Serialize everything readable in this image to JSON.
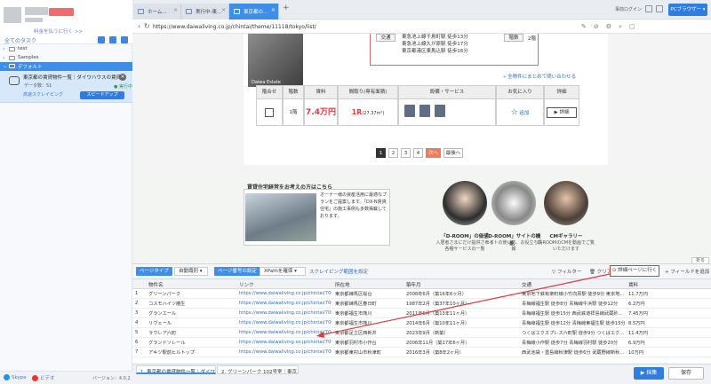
{
  "sidebar": {
    "back_link": "料金を払うに行く >>",
    "all_tasks": "全てのタスク",
    "tree": [
      {
        "label": "test"
      },
      {
        "label": "Samples"
      },
      {
        "label": "デフォルト"
      }
    ],
    "task": {
      "title": "東京都の賃貸物件一覧｜ダイワハウスの賃貸...",
      "count": "データ数：51",
      "status": "● 実行中",
      "mode": "高速スクレイピング",
      "speed_button": "スピードアップ"
    },
    "footer": {
      "skype": "Skype",
      "video": "ビデオ",
      "version": "バージョン：4.0.2"
    }
  },
  "browser": {
    "tabs": [
      {
        "label": "ホーム..."
      },
      {
        "label": "実行中-東..."
      },
      {
        "label": "東京都の..."
      }
    ],
    "new_tab": "+",
    "login": "事前ログイン",
    "pc_browser": "PCブラウザー ▾",
    "url": "https://www.daiwaliving.co.jp/chintai/theme/11118/tokyo/list/"
  },
  "listing": {
    "photo_label": "Daiwa Estate",
    "access_label": "交通",
    "access_lines": [
      "東急池上線千鳥町駅 徒歩13分",
      "東急池上線久が原駅 徒歩17分",
      "東京都港区東馬込駅 徒歩16分"
    ],
    "layout_label": "階数",
    "layout_value": "2階",
    "bulk_link": "» 全物件にまとめて問い合わせる",
    "table_headers": [
      "階合せ",
      "階数",
      "賃料",
      "間取り(専有面積)",
      "設備・サービス",
      "お気に入り",
      "詳細"
    ],
    "row": {
      "floor": "1階",
      "rent": "7.4万円",
      "layout": "1R",
      "area": "(27.37m²)",
      "fav": "追加",
      "detail": "▶ 詳細"
    }
  },
  "pagination": {
    "pages": [
      "1",
      "2",
      "3",
      "4"
    ],
    "next": "次へ",
    "last": "最後へ"
  },
  "promo": {
    "title": "賃貸住宅経営をお考えの方はこちら",
    "text": "オーナー様の資産活用に最適なプランをご提案します。「DX-N賃貸住宅」の施工事例も多数掲載しております。",
    "features": [
      {
        "title": "「D-ROOM」の価値",
        "sub": "入居者さまにだけ提供される各種サービスの一覧"
      },
      {
        "title": "「D-ROOM」サイトの機能",
        "sub": "サイトの使い方、お役立ち情報"
      },
      {
        "title": "CMギャラリー",
        "sub": "D-ROOMのCMを動画でご覧いただけます"
      }
    ]
  },
  "data_panel": {
    "page_type_label": "ページタイプ",
    "page_type_value": "自動識別 ▾",
    "page_load_label": "ページ番号の設定",
    "page_load_value": "XPathを確保 ▾",
    "scroll_link": "スクレイピング範囲を設定",
    "filter": "フィルター",
    "clear": "クリア",
    "go_detail": "詳細ページに行く",
    "add_field": "+ フィールドを追加",
    "collapse": "折る",
    "columns": [
      "物件名",
      "リンク",
      "所在地",
      "築年月",
      "交通",
      "賃料"
    ],
    "rows": [
      [
        "1",
        "グリーンパーク",
        "https://www.daiwaliving.co.jp/chintai/70000...",
        "東京都練馬区桜台",
        "2008年6月（築16年6ヶ月）",
        "東京地下鉄有楽町線小竹向原駅 徒歩9分 東京地...",
        "11.7万円"
      ],
      [
        "2",
        "コスモハイツ椿生",
        "https://www.daiwaliving.co.jp/chintai/70000...",
        "東京都練馬区春日町",
        "1987年2月（築37年10ヶ月）",
        "青梅線福生駅 徒歩8分 青梅線牛浜駅 徒歩12分",
        "6.2万円"
      ],
      [
        "3",
        "グランエール",
        "https://www.daiwaliving.co.jp/chintai/70000...",
        "東京都福生市熊川",
        "2011年6月（築13年11ヶ月）",
        "青梅線福生駅 徒歩15分 西武鉄道拝島線武蔵砂...",
        "7.45万円"
      ],
      [
        "4",
        "リヴェール",
        "https://www.daiwaliving.co.jp/chintai/70000...",
        "東京都福生市熊川",
        "2014年6月（築10年11ヶ月）",
        "青梅線福生駅 徒歩12分 青梅線東福生駅 徒歩15分",
        "8.5万円"
      ],
      [
        "5",
        "ラウレア六町",
        "https://www.daiwaliving.co.jp/chintai/70000...",
        "東京都足立区西新井",
        "2023年9月（新築）",
        "つくばエクスプレス六町駅 徒歩9分 つくばエク...",
        "11.4万円"
      ],
      [
        "6",
        "グランドソレール",
        "https://www.daiwaliving.co.jp/chintai/70000...",
        "東京都羽村市小作台",
        "2006年11月（築17年6ヶ月）",
        "青梅線小作駅 徒歩7分 青梅線羽村駅 徒歩20分",
        "6.9万円"
      ],
      [
        "7",
        "アキツ駅前ヒルトップ",
        "https://www.daiwaliving.co.jp/chintai/70000...",
        "東京都東村山市秋津町",
        "2016年3月（築8年2ヶ月）",
        "西武池袋・豊島線秋津駅 徒歩6分 武蔵野線新秋...",
        "10万円"
      ]
    ]
  },
  "bottom": {
    "tabs": [
      "1. 東京都の賃貸物件一覧｜ダイワ...",
      "2. グリーンパーク 102号室｜東京..."
    ],
    "collect": "▶ 採集",
    "save": "保存"
  },
  "colors": {
    "accent": "#3d8ee8",
    "highlight_border": "#e03a3a",
    "rent_red": "#e13b3b"
  }
}
